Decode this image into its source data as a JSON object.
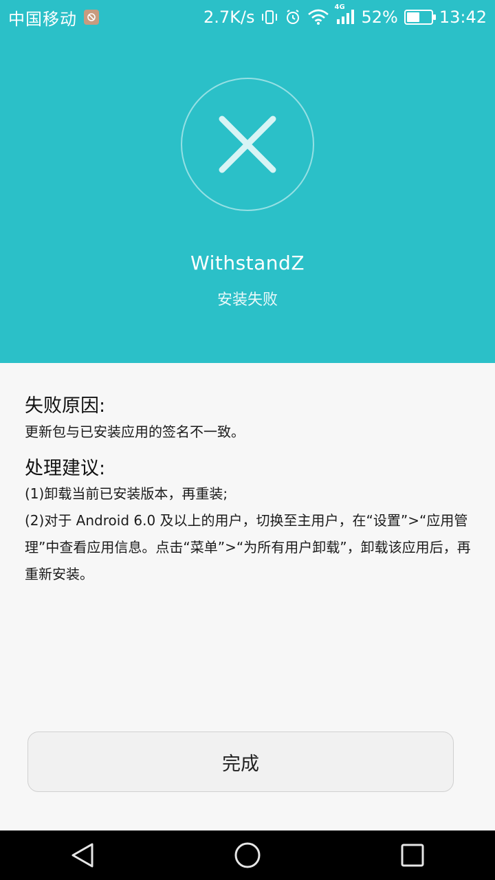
{
  "status_bar": {
    "carrier": "中国移动",
    "speed": "2.7K/s",
    "network_type": "4G",
    "battery_percent": "52%",
    "battery_level": 0.52,
    "time": "13:42"
  },
  "header": {
    "app_name": "WithstandZ",
    "status": "安装失败",
    "background_color": "#2bc0c8",
    "icon": "close-icon"
  },
  "content": {
    "reason_title": "失败原因:",
    "reason_text": "更新包与已安装应用的签名不一致。",
    "suggestion_title": "处理建议:",
    "suggestion_1": "(1)卸载当前已安装版本，再重装;",
    "suggestion_2": "(2)对于 Android 6.0 及以上的用户，切换至主用户，在“设置”>“应用管理”中查看应用信息。点击“菜单”>“为所有用户卸载”，卸载该应用后，再重新安装。"
  },
  "actions": {
    "done_label": "完成"
  },
  "nav": {
    "back_icon": "back-triangle-icon",
    "home_icon": "home-circle-icon",
    "recents_icon": "recents-square-icon"
  }
}
